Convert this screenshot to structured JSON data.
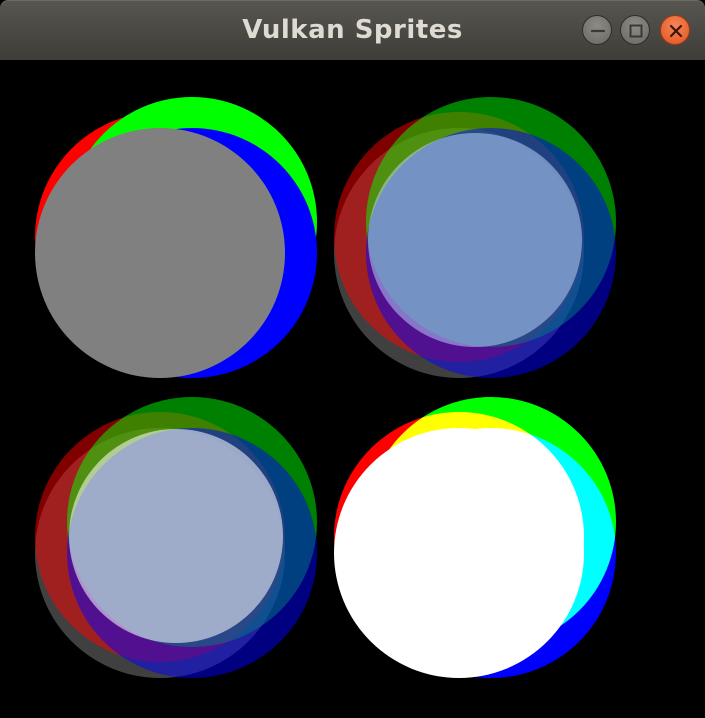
{
  "window": {
    "title": "Vulkan Sprites",
    "buttons": [
      {
        "name": "minimize-button",
        "icon": "minimize-icon"
      },
      {
        "name": "maximize-button",
        "icon": "maximize-icon"
      },
      {
        "name": "close-button",
        "icon": "close-icon"
      }
    ]
  },
  "colors": {
    "titlebar": "#4a4945",
    "title_text": "#dfdbd2",
    "close_button": "#e95420",
    "canvas_background": "#000000",
    "sprite_red": "#ff0000",
    "sprite_green": "#00ff00",
    "sprite_blue": "#0000ff",
    "sprite_gray": "#808080"
  },
  "sprite_groups": [
    {
      "name": "sprite-group-opaque",
      "blend_mode": "opaque",
      "gray_value": "#808080"
    },
    {
      "name": "sprite-group-alpha-gray",
      "blend_mode": "alpha",
      "gray_value": "#808080"
    },
    {
      "name": "sprite-group-alpha-light",
      "blend_mode": "alpha",
      "gray_value": "#c0c0c0"
    },
    {
      "name": "sprite-group-additive",
      "blend_mode": "additive",
      "gray_value": "#808080"
    }
  ]
}
